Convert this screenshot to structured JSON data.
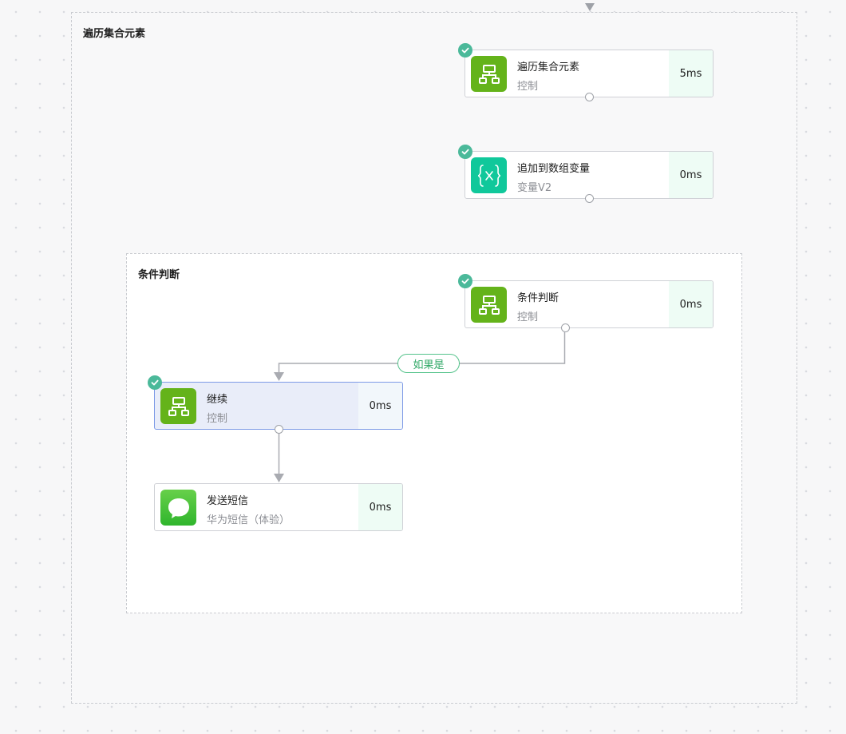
{
  "outer_group": {
    "title": "遍历集合元素"
  },
  "inner_group": {
    "title": "条件判断"
  },
  "nodes": {
    "loop": {
      "name": "遍历集合元素",
      "sub": "控制",
      "time": "5ms",
      "icon": "flow-chart-icon",
      "status": "success"
    },
    "append": {
      "name": "追加到数组变量",
      "sub": "变量V2",
      "time": "0ms",
      "icon": "variable-braces-icon",
      "status": "success"
    },
    "condition": {
      "name": "条件判断",
      "sub": "控制",
      "time": "0ms",
      "icon": "flow-chart-icon",
      "status": "success"
    },
    "continue": {
      "name": "继续",
      "sub": "控制",
      "time": "0ms",
      "icon": "flow-chart-icon",
      "status": "success",
      "selected": true
    },
    "sms": {
      "name": "发送短信",
      "sub": "华为短信（体验）",
      "time": "0ms",
      "icon": "message-bubble-icon"
    }
  },
  "branch": {
    "label": "如果是"
  },
  "colors": {
    "control_icon": "#64b31a",
    "variable_icon": "#10c89b",
    "sms_icon": "#3fbd35",
    "success_check": "#4bb99a",
    "branch_label": "#2fa866",
    "time_cell": "#eefcf5",
    "selected_border": "#7d9ae6"
  }
}
